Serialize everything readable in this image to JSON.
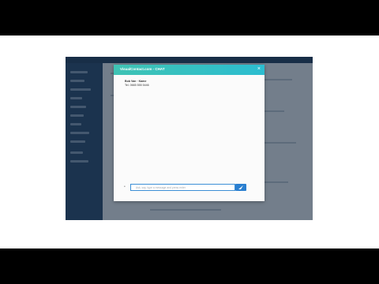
{
  "window": {
    "title": "VisualContact.com - CHAT",
    "close_icon": "×"
  },
  "conversation": {
    "contact_name": "Bob Van · Kame",
    "contact_tel": "Tel. 0665 555 5446"
  },
  "composer": {
    "placeholder": "Ask, say, type a message and press enter",
    "attach_icon": "paperclip-icon",
    "send_icon": "send-icon"
  },
  "colors": {
    "header_start": "#3fc3b4",
    "header_end": "#2cbdd0",
    "send_button": "#2a7fd0"
  }
}
